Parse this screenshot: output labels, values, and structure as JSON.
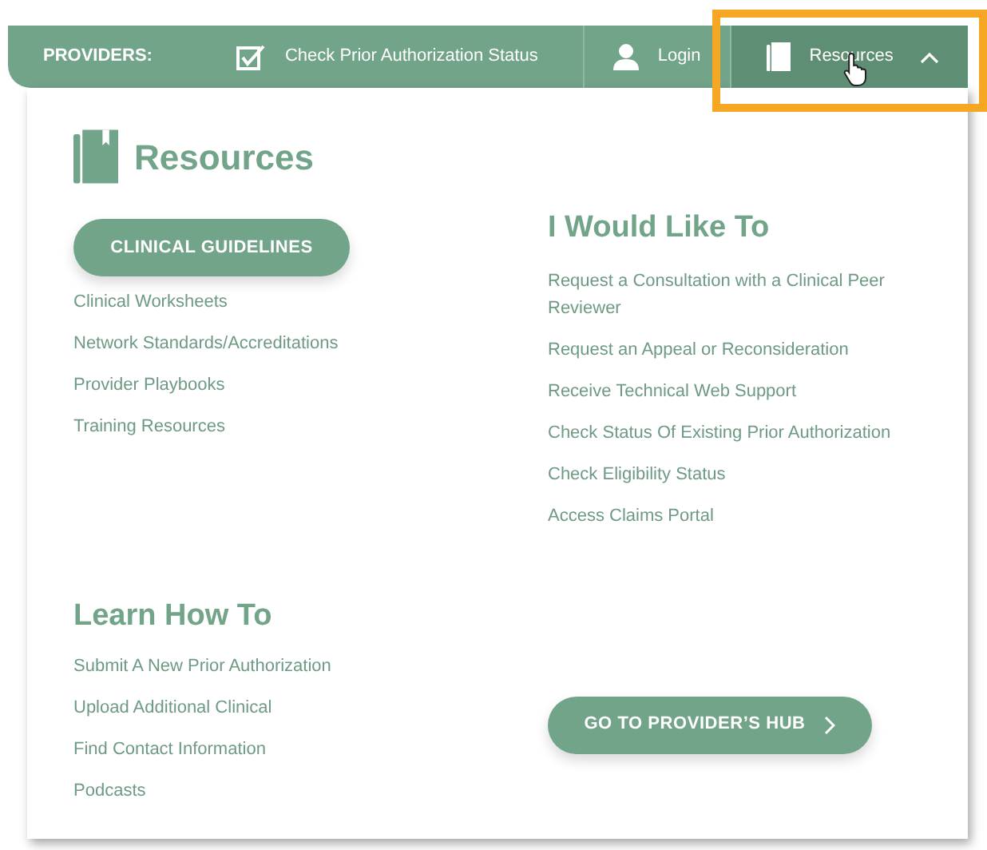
{
  "nav": {
    "label": "PROVIDERS:",
    "items": [
      {
        "kind": "check",
        "label": "Check Prior Authorization Status",
        "selected": false
      },
      {
        "kind": "user",
        "label": "Login",
        "selected": false
      },
      {
        "kind": "book",
        "label": "Resources",
        "selected": true,
        "expanded": true
      }
    ]
  },
  "menu": {
    "title": "Resources",
    "guidelines_button": "CLINICAL GUIDELINES",
    "resource_links": [
      "Clinical Worksheets",
      "Network Standards/Accreditations",
      "Provider Playbooks",
      "Training Resources"
    ],
    "would_like_title": "I Would Like To",
    "would_like_links": [
      "Request a Consultation with a Clinical Peer Reviewer",
      "Request an Appeal or Reconsideration",
      "Receive Technical Web Support",
      "Check Status Of Existing Prior Authorization",
      "Check Eligibility Status",
      "Access Claims Portal"
    ],
    "learn_title": "Learn How To",
    "learn_links": [
      "Submit A New Prior Authorization",
      "Upload Additional Clinical",
      "Find Contact Information",
      "Podcasts"
    ],
    "hub_button": "GO TO PROVIDER’S HUB"
  }
}
